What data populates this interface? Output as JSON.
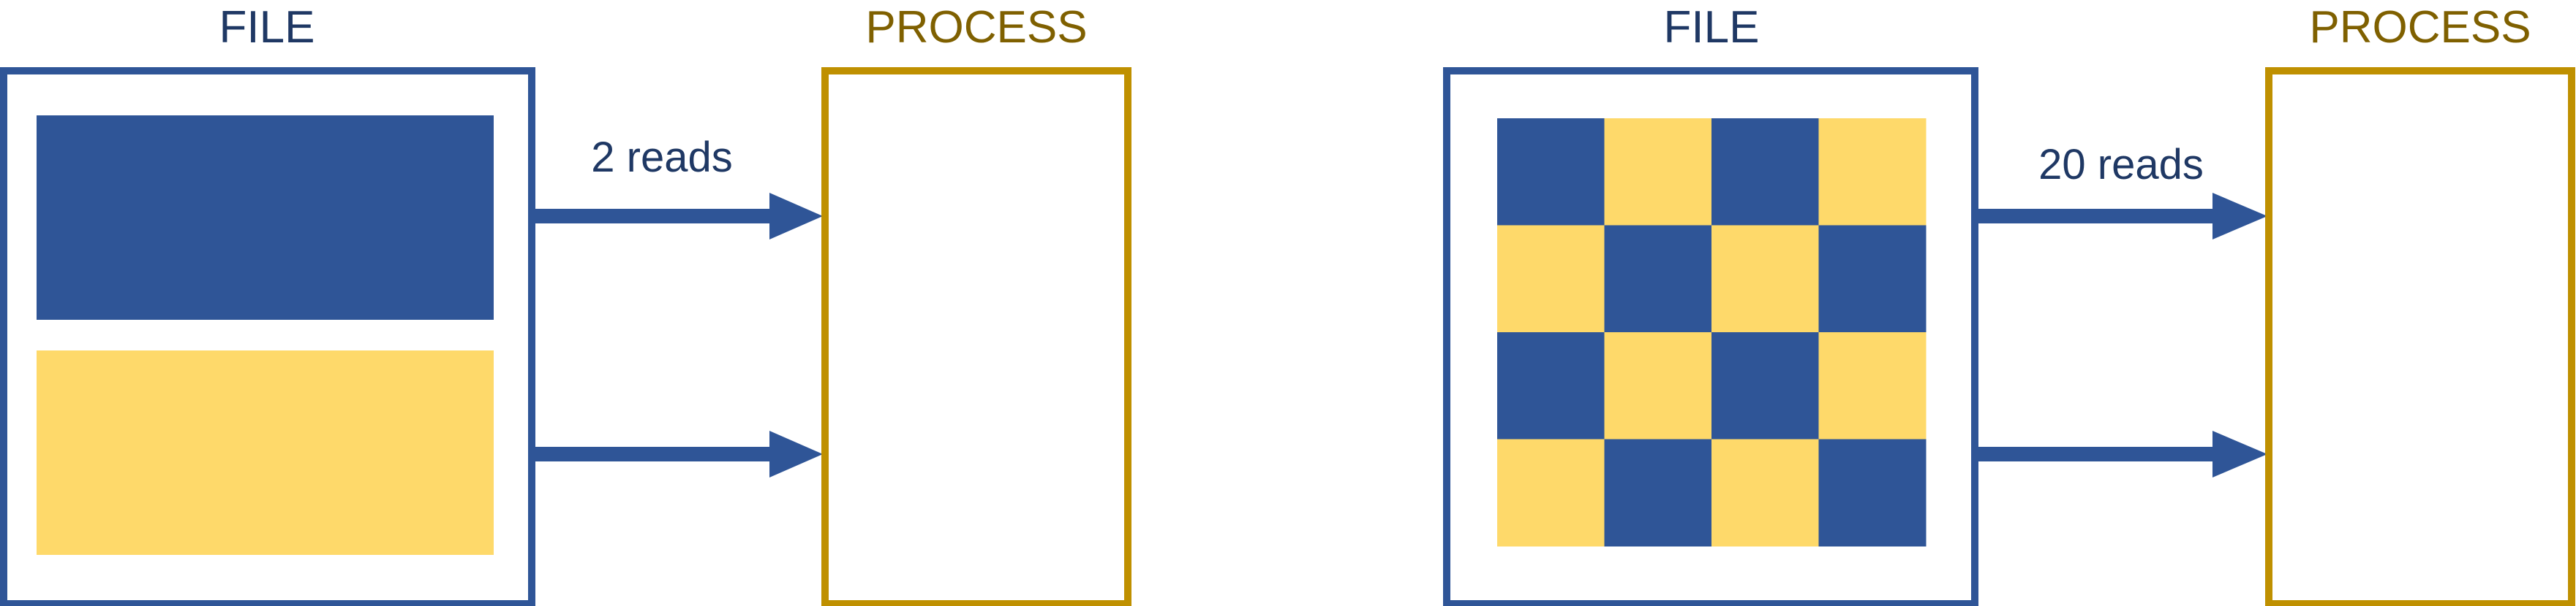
{
  "left_panel": {
    "file_title": "FILE",
    "process_title": "PROCESS",
    "arrow_label": "2 reads"
  },
  "right_panel": {
    "file_title": "FILE",
    "process_title": "PROCESS",
    "arrow_label": "20 reads",
    "grid": [
      [
        "blue",
        "yellow",
        "blue",
        "yellow"
      ],
      [
        "yellow",
        "blue",
        "yellow",
        "blue"
      ],
      [
        "blue",
        "yellow",
        "blue",
        "yellow"
      ],
      [
        "yellow",
        "blue",
        "yellow",
        "blue"
      ]
    ]
  },
  "colors": {
    "blue": "#2f5597",
    "yellow": "#fed96a",
    "file_title": "#1f3864",
    "process_title": "#7f6000",
    "process_border": "#bf9000",
    "label": "#1f3864"
  }
}
